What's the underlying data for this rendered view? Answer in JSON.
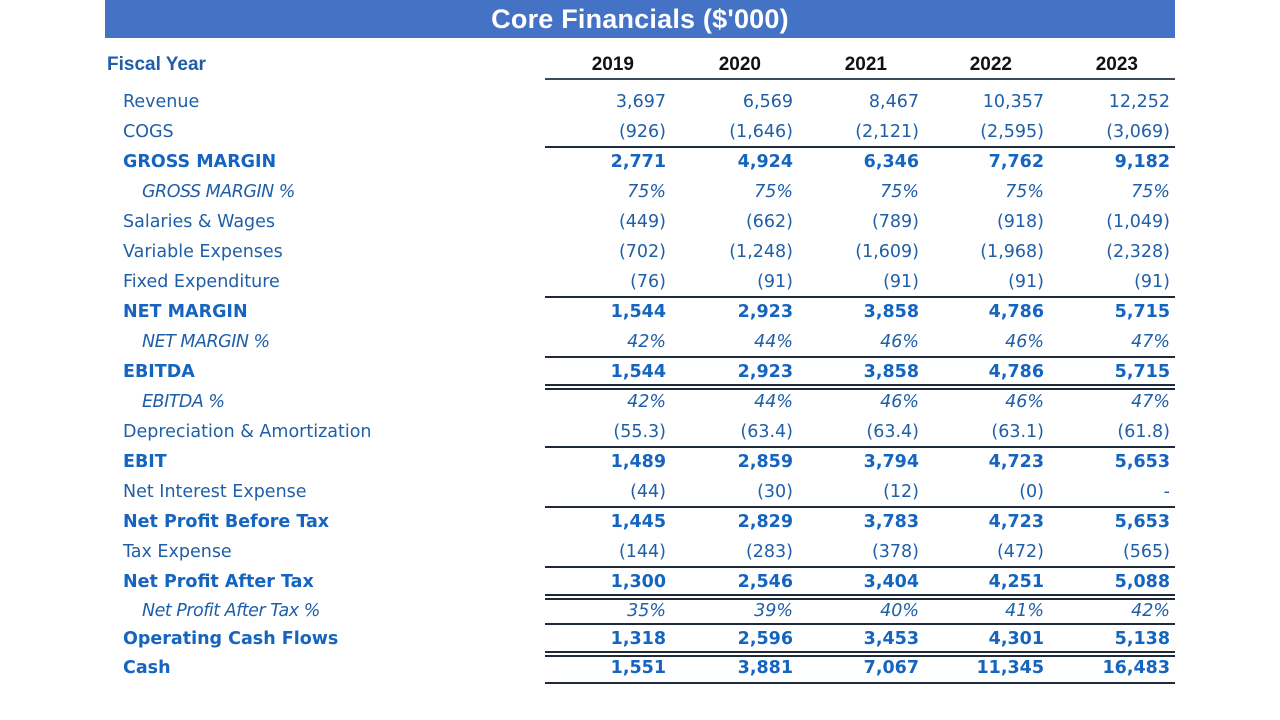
{
  "title": "Core Financials ($'000)",
  "header": {
    "fiscal_year_label": "Fiscal Year",
    "years": [
      "2019",
      "2020",
      "2021",
      "2022",
      "2023"
    ]
  },
  "colors": {
    "title_bar": "#4472c4",
    "title_text": "#ffffff",
    "label_text": "#1f5fa8",
    "year_text": "#111111",
    "rule": "#1e2a3a"
  },
  "rows": [
    {
      "label": "Revenue",
      "style": "normal",
      "values": [
        "3,697",
        "6,569",
        "8,467",
        "10,357",
        "12,252"
      ]
    },
    {
      "label": "COGS",
      "style": "normal",
      "values": [
        "(926)",
        "(1,646)",
        "(2,121)",
        "(2,595)",
        "(3,069)"
      ]
    },
    {
      "label": "GROSS MARGIN",
      "style": "bold",
      "values": [
        "2,771",
        "4,924",
        "6,346",
        "7,762",
        "9,182"
      ]
    },
    {
      "label": "GROSS MARGIN %",
      "style": "pct",
      "values": [
        "75%",
        "75%",
        "75%",
        "75%",
        "75%"
      ]
    },
    {
      "label": "Salaries & Wages",
      "style": "normal",
      "values": [
        "(449)",
        "(662)",
        "(789)",
        "(918)",
        "(1,049)"
      ]
    },
    {
      "label": "Variable Expenses",
      "style": "normal",
      "values": [
        "(702)",
        "(1,248)",
        "(1,609)",
        "(1,968)",
        "(2,328)"
      ]
    },
    {
      "label": "Fixed Expenditure",
      "style": "normal",
      "values": [
        "(76)",
        "(91)",
        "(91)",
        "(91)",
        "(91)"
      ]
    },
    {
      "label": "NET MARGIN",
      "style": "bold",
      "values": [
        "1,544",
        "2,923",
        "3,858",
        "4,786",
        "5,715"
      ]
    },
    {
      "label": "NET MARGIN %",
      "style": "pct",
      "values": [
        "42%",
        "44%",
        "46%",
        "46%",
        "47%"
      ]
    },
    {
      "label": "EBITDA",
      "style": "bold",
      "values": [
        "1,544",
        "2,923",
        "3,858",
        "4,786",
        "5,715"
      ]
    },
    {
      "label": "EBITDA %",
      "style": "pct",
      "values": [
        "42%",
        "44%",
        "46%",
        "46%",
        "47%"
      ]
    },
    {
      "label": "Depreciation & Amortization",
      "style": "normal",
      "values": [
        "(55.3)",
        "(63.4)",
        "(63.4)",
        "(63.1)",
        "(61.8)"
      ]
    },
    {
      "label": "EBIT",
      "style": "bold",
      "values": [
        "1,489",
        "2,859",
        "3,794",
        "4,723",
        "5,653"
      ]
    },
    {
      "label": "Net Interest Expense",
      "style": "normal",
      "values": [
        "(44)",
        "(30)",
        "(12)",
        "(0)",
        "-"
      ]
    },
    {
      "label": "Net Profit Before Tax",
      "style": "bold",
      "values": [
        "1,445",
        "2,829",
        "3,783",
        "4,723",
        "5,653"
      ]
    },
    {
      "label": "Tax Expense",
      "style": "normal",
      "values": [
        "(144)",
        "(283)",
        "(378)",
        "(472)",
        "(565)"
      ]
    },
    {
      "label": "Net Profit After Tax",
      "style": "bold",
      "values": [
        "1,300",
        "2,546",
        "3,404",
        "4,251",
        "5,088"
      ]
    },
    {
      "label": "Net Profit After Tax %",
      "style": "pct",
      "values": [
        "35%",
        "39%",
        "40%",
        "41%",
        "42%"
      ]
    },
    {
      "label": "Operating Cash Flows",
      "style": "bold",
      "values": [
        "1,318",
        "2,596",
        "3,453",
        "4,301",
        "5,138"
      ]
    },
    {
      "label": "Cash",
      "style": "bold",
      "values": [
        "1,551",
        "3,881",
        "7,067",
        "11,345",
        "16,483"
      ]
    }
  ]
}
